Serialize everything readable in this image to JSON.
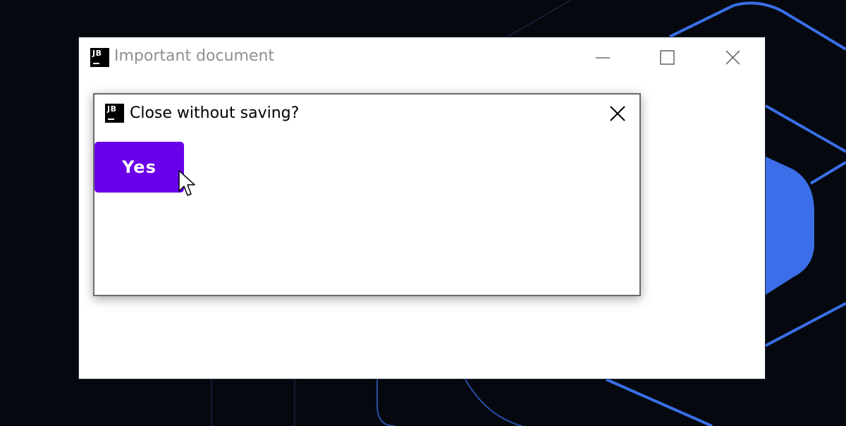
{
  "window": {
    "title": "Important document",
    "logo_text": "JB"
  },
  "dialog": {
    "title": "Close without saving?",
    "logo_text": "JB",
    "yes_label": "Yes"
  },
  "colors": {
    "desktop_background": "#05090f",
    "accent_blue": "#3b6ee8",
    "button_purple": "#6a00ea"
  },
  "icons": {
    "minimize": "minimize-icon",
    "maximize": "maximize-icon",
    "close": "close-icon",
    "cursor": "mouse-pointer-icon"
  }
}
